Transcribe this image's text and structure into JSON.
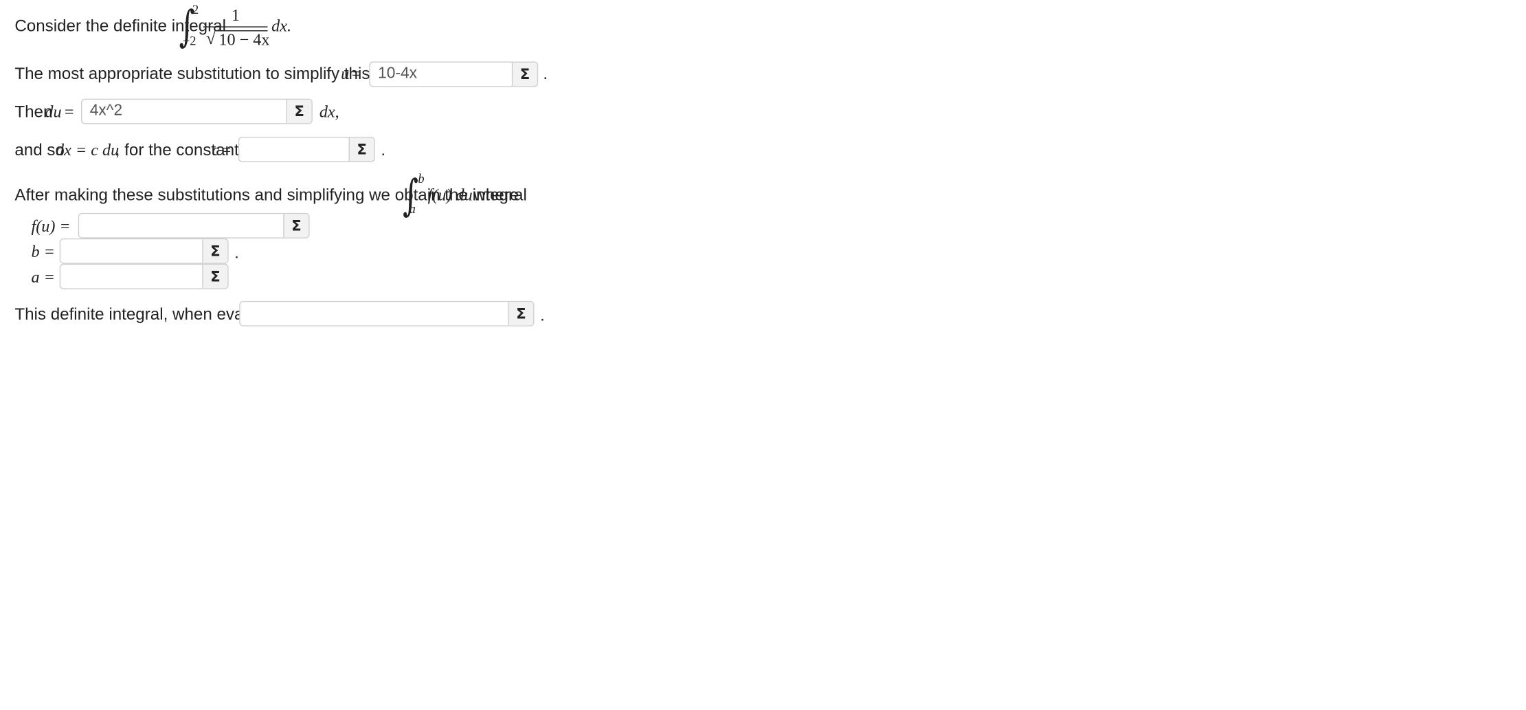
{
  "q1": {
    "text": "Consider the definite integral",
    "integral": {
      "upper": "2",
      "lower": "−2",
      "numerator": "1",
      "radicand": "10 − 4x",
      "differential": "dx."
    }
  },
  "q2": {
    "text": "The most appropriate substitution to simplify this integral is",
    "var": "u",
    "eq": "=",
    "value": "10-4x",
    "period": "."
  },
  "q3": {
    "text": "Then",
    "var": "du",
    "eq": "=",
    "value": "4x^2",
    "suffix": "dx,"
  },
  "q4": {
    "text_start": "and so",
    "expr": "dx = c du",
    "text_mid": ", for the constant",
    "var": "c",
    "eq": "=",
    "value": "",
    "period": "."
  },
  "q5": {
    "text": "After making these substitutions and simplifying we obtain the integral",
    "upper": "b",
    "lower": "a",
    "integrand": "f(u) du",
    "text_end": "where"
  },
  "fu": {
    "label": "f(u) =",
    "value": ""
  },
  "b_field": {
    "label": "b =",
    "value": "",
    "period": "."
  },
  "a_field": {
    "label": "a =",
    "value": ""
  },
  "q6": {
    "text": "This definite integral, when evaluated, is",
    "value": "",
    "period": "."
  },
  "sigma_icon": "Σ"
}
